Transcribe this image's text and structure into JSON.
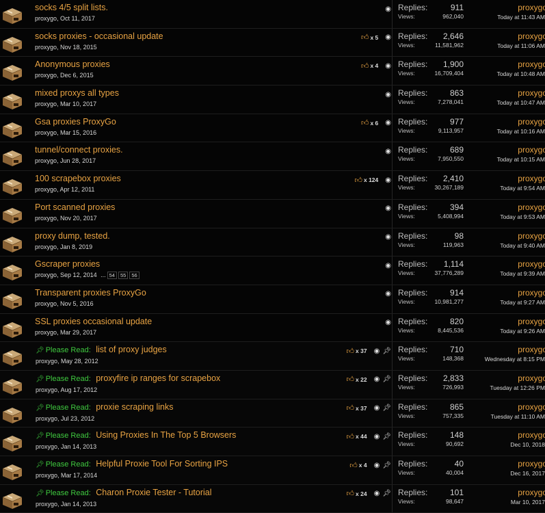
{
  "labels": {
    "replies": "Replies:",
    "views": "Views:",
    "please_read": "Please Read:",
    "like_prefix": "x",
    "ellipsis": "..."
  },
  "colors": {
    "title": "#e8a343",
    "sticky_prefix": "#3fc93f",
    "background": "#000000"
  },
  "icons": {
    "thread": "box-icon",
    "like": "thumbs-up-icon",
    "watched": "eye-icon",
    "sticky": "pin-icon"
  },
  "threads": [
    {
      "title": "socks 4/5 split lists.",
      "author": "proxygo",
      "date": "Oct 11, 2017",
      "likes": "",
      "sticky": false,
      "pages": [],
      "replies": "911",
      "views": "962,040",
      "last_user": "proxygo",
      "last_time": "Today at 11:43 AM"
    },
    {
      "title": "socks proxies - occasional update",
      "author": "proxygo",
      "date": "Nov 18, 2015",
      "likes": "5",
      "sticky": false,
      "pages": [],
      "replies": "2,646",
      "views": "11,581,962",
      "last_user": "proxygo",
      "last_time": "Today at 11:06 AM"
    },
    {
      "title": "Anonymous proxies",
      "author": "proxygo",
      "date": "Dec 6, 2015",
      "likes": "4",
      "sticky": false,
      "pages": [],
      "replies": "1,900",
      "views": "16,709,404",
      "last_user": "proxygo",
      "last_time": "Today at 10:48 AM"
    },
    {
      "title": "mixed proxys all types",
      "author": "proxygo",
      "date": "Mar 10, 2017",
      "likes": "",
      "sticky": false,
      "pages": [],
      "replies": "863",
      "views": "7,278,041",
      "last_user": "proxygo",
      "last_time": "Today at 10:47 AM"
    },
    {
      "title": "Gsa proxies ProxyGo",
      "author": "proxygo",
      "date": "Mar 15, 2016",
      "likes": "6",
      "sticky": false,
      "pages": [],
      "replies": "977",
      "views": "9,113,957",
      "last_user": "proxygo",
      "last_time": "Today at 10:16 AM"
    },
    {
      "title": "tunnel/connect proxies.",
      "author": "proxygo",
      "date": "Jun 28, 2017",
      "likes": "",
      "sticky": false,
      "pages": [],
      "replies": "689",
      "views": "7,950,550",
      "last_user": "proxygo",
      "last_time": "Today at 10:15 AM"
    },
    {
      "title": "100 scrapebox proxies",
      "author": "proxygo",
      "date": "Apr 12, 2011",
      "likes": "124",
      "sticky": false,
      "pages": [],
      "replies": "2,410",
      "views": "30,267,189",
      "last_user": "proxygo",
      "last_time": "Today at 9:54 AM"
    },
    {
      "title": "Port scanned proxies",
      "author": "proxygo",
      "date": "Nov 20, 2017",
      "likes": "",
      "sticky": false,
      "pages": [],
      "replies": "394",
      "views": "5,408,994",
      "last_user": "proxygo",
      "last_time": "Today at 9:53 AM"
    },
    {
      "title": "proxy dump, tested.",
      "author": "proxygo",
      "date": "Jan 8, 2019",
      "likes": "",
      "sticky": false,
      "pages": [],
      "replies": "98",
      "views": "119,963",
      "last_user": "proxygo",
      "last_time": "Today at 9:40 AM"
    },
    {
      "title": "Gscraper proxies",
      "author": "proxygo",
      "date": "Sep 12, 2014",
      "likes": "",
      "sticky": false,
      "pages": [
        "54",
        "55",
        "56"
      ],
      "replies": "1,114",
      "views": "37,776,289",
      "last_user": "proxygo",
      "last_time": "Today at 9:39 AM"
    },
    {
      "title": "Transparent proxies ProxyGo",
      "author": "proxygo",
      "date": "Nov 5, 2016",
      "likes": "",
      "sticky": false,
      "pages": [],
      "replies": "914",
      "views": "10,981,277",
      "last_user": "proxygo",
      "last_time": "Today at 9:27 AM"
    },
    {
      "title": "SSL proxies occasional update",
      "author": "proxygo",
      "date": "Mar 29, 2017",
      "likes": "",
      "sticky": false,
      "pages": [],
      "replies": "820",
      "views": "8,445,536",
      "last_user": "proxygo",
      "last_time": "Today at 9:26 AM"
    },
    {
      "title": "list of proxy judges",
      "author": "proxygo",
      "date": "May 28, 2012",
      "likes": "37",
      "sticky": true,
      "pages": [],
      "replies": "710",
      "views": "148,368",
      "last_user": "proxygo",
      "last_time": "Wednesday at 8:15 PM"
    },
    {
      "title": "proxyfire ip ranges for scrapebox",
      "author": "proxygo",
      "date": "Aug 17, 2012",
      "likes": "22",
      "sticky": true,
      "pages": [],
      "replies": "2,833",
      "views": "726,993",
      "last_user": "proxygo",
      "last_time": "Tuesday at 12:26 PM"
    },
    {
      "title": "proxie scraping links",
      "author": "proxygo",
      "date": "Jul 23, 2012",
      "likes": "37",
      "sticky": true,
      "pages": [],
      "replies": "865",
      "views": "757,335",
      "last_user": "proxygo",
      "last_time": "Tuesday at 11:10 AM"
    },
    {
      "title": "Using Proxies In The Top 5 Browsers",
      "author": "proxygo",
      "date": "Jan 14, 2013",
      "likes": "44",
      "sticky": true,
      "pages": [],
      "replies": "148",
      "views": "90,692",
      "last_user": "proxygo",
      "last_time": "Dec 10, 2018"
    },
    {
      "title": "Helpful Proxie Tool For Sorting IPS",
      "author": "proxygo",
      "date": "Mar 17, 2014",
      "likes": "4",
      "sticky": true,
      "pages": [],
      "replies": "40",
      "views": "40,004",
      "last_user": "proxygo",
      "last_time": "Dec 16, 2017"
    },
    {
      "title": "Charon Proxie Tester - Tutorial",
      "author": "proxygo",
      "date": "Jan 14, 2013",
      "likes": "24",
      "sticky": true,
      "pages": [],
      "replies": "101",
      "views": "98,647",
      "last_user": "proxygo",
      "last_time": "Mar 10, 2017"
    }
  ]
}
